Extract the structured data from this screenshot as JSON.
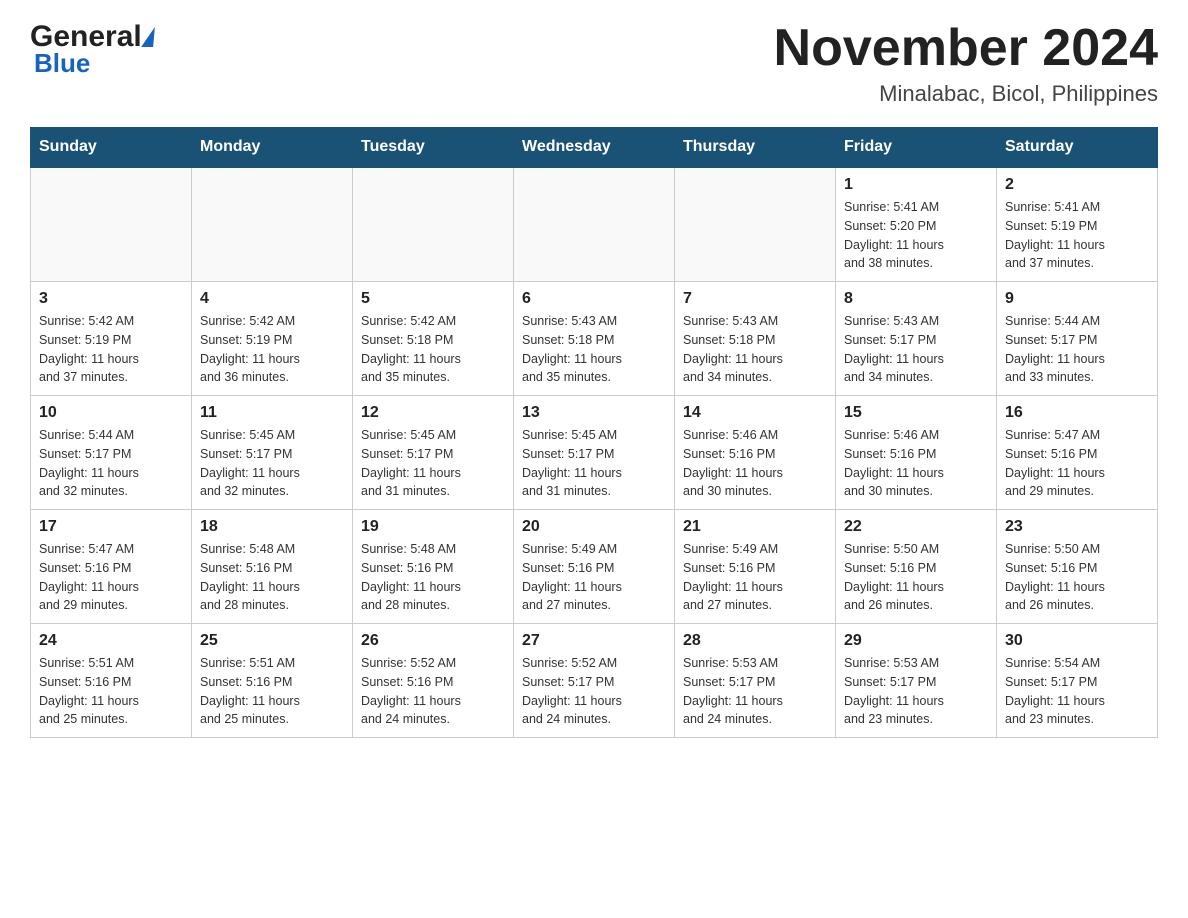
{
  "header": {
    "month_title": "November 2024",
    "location": "Minalabac, Bicol, Philippines",
    "logo_general": "General",
    "logo_blue": "Blue"
  },
  "weekdays": [
    "Sunday",
    "Monday",
    "Tuesday",
    "Wednesday",
    "Thursday",
    "Friday",
    "Saturday"
  ],
  "weeks": [
    [
      {
        "date": "",
        "info": ""
      },
      {
        "date": "",
        "info": ""
      },
      {
        "date": "",
        "info": ""
      },
      {
        "date": "",
        "info": ""
      },
      {
        "date": "",
        "info": ""
      },
      {
        "date": "1",
        "info": "Sunrise: 5:41 AM\nSunset: 5:20 PM\nDaylight: 11 hours\nand 38 minutes."
      },
      {
        "date": "2",
        "info": "Sunrise: 5:41 AM\nSunset: 5:19 PM\nDaylight: 11 hours\nand 37 minutes."
      }
    ],
    [
      {
        "date": "3",
        "info": "Sunrise: 5:42 AM\nSunset: 5:19 PM\nDaylight: 11 hours\nand 37 minutes."
      },
      {
        "date": "4",
        "info": "Sunrise: 5:42 AM\nSunset: 5:19 PM\nDaylight: 11 hours\nand 36 minutes."
      },
      {
        "date": "5",
        "info": "Sunrise: 5:42 AM\nSunset: 5:18 PM\nDaylight: 11 hours\nand 35 minutes."
      },
      {
        "date": "6",
        "info": "Sunrise: 5:43 AM\nSunset: 5:18 PM\nDaylight: 11 hours\nand 35 minutes."
      },
      {
        "date": "7",
        "info": "Sunrise: 5:43 AM\nSunset: 5:18 PM\nDaylight: 11 hours\nand 34 minutes."
      },
      {
        "date": "8",
        "info": "Sunrise: 5:43 AM\nSunset: 5:17 PM\nDaylight: 11 hours\nand 34 minutes."
      },
      {
        "date": "9",
        "info": "Sunrise: 5:44 AM\nSunset: 5:17 PM\nDaylight: 11 hours\nand 33 minutes."
      }
    ],
    [
      {
        "date": "10",
        "info": "Sunrise: 5:44 AM\nSunset: 5:17 PM\nDaylight: 11 hours\nand 32 minutes."
      },
      {
        "date": "11",
        "info": "Sunrise: 5:45 AM\nSunset: 5:17 PM\nDaylight: 11 hours\nand 32 minutes."
      },
      {
        "date": "12",
        "info": "Sunrise: 5:45 AM\nSunset: 5:17 PM\nDaylight: 11 hours\nand 31 minutes."
      },
      {
        "date": "13",
        "info": "Sunrise: 5:45 AM\nSunset: 5:17 PM\nDaylight: 11 hours\nand 31 minutes."
      },
      {
        "date": "14",
        "info": "Sunrise: 5:46 AM\nSunset: 5:16 PM\nDaylight: 11 hours\nand 30 minutes."
      },
      {
        "date": "15",
        "info": "Sunrise: 5:46 AM\nSunset: 5:16 PM\nDaylight: 11 hours\nand 30 minutes."
      },
      {
        "date": "16",
        "info": "Sunrise: 5:47 AM\nSunset: 5:16 PM\nDaylight: 11 hours\nand 29 minutes."
      }
    ],
    [
      {
        "date": "17",
        "info": "Sunrise: 5:47 AM\nSunset: 5:16 PM\nDaylight: 11 hours\nand 29 minutes."
      },
      {
        "date": "18",
        "info": "Sunrise: 5:48 AM\nSunset: 5:16 PM\nDaylight: 11 hours\nand 28 minutes."
      },
      {
        "date": "19",
        "info": "Sunrise: 5:48 AM\nSunset: 5:16 PM\nDaylight: 11 hours\nand 28 minutes."
      },
      {
        "date": "20",
        "info": "Sunrise: 5:49 AM\nSunset: 5:16 PM\nDaylight: 11 hours\nand 27 minutes."
      },
      {
        "date": "21",
        "info": "Sunrise: 5:49 AM\nSunset: 5:16 PM\nDaylight: 11 hours\nand 27 minutes."
      },
      {
        "date": "22",
        "info": "Sunrise: 5:50 AM\nSunset: 5:16 PM\nDaylight: 11 hours\nand 26 minutes."
      },
      {
        "date": "23",
        "info": "Sunrise: 5:50 AM\nSunset: 5:16 PM\nDaylight: 11 hours\nand 26 minutes."
      }
    ],
    [
      {
        "date": "24",
        "info": "Sunrise: 5:51 AM\nSunset: 5:16 PM\nDaylight: 11 hours\nand 25 minutes."
      },
      {
        "date": "25",
        "info": "Sunrise: 5:51 AM\nSunset: 5:16 PM\nDaylight: 11 hours\nand 25 minutes."
      },
      {
        "date": "26",
        "info": "Sunrise: 5:52 AM\nSunset: 5:16 PM\nDaylight: 11 hours\nand 24 minutes."
      },
      {
        "date": "27",
        "info": "Sunrise: 5:52 AM\nSunset: 5:17 PM\nDaylight: 11 hours\nand 24 minutes."
      },
      {
        "date": "28",
        "info": "Sunrise: 5:53 AM\nSunset: 5:17 PM\nDaylight: 11 hours\nand 24 minutes."
      },
      {
        "date": "29",
        "info": "Sunrise: 5:53 AM\nSunset: 5:17 PM\nDaylight: 11 hours\nand 23 minutes."
      },
      {
        "date": "30",
        "info": "Sunrise: 5:54 AM\nSunset: 5:17 PM\nDaylight: 11 hours\nand 23 minutes."
      }
    ]
  ]
}
